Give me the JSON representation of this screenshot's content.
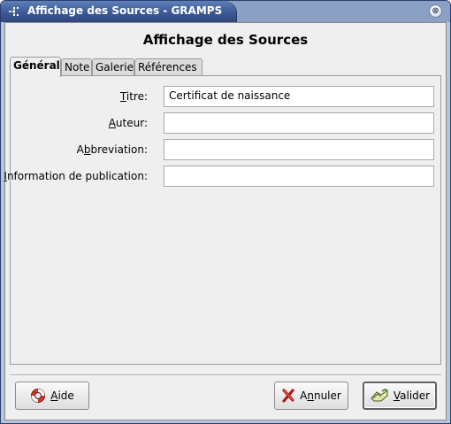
{
  "window": {
    "title": "Affichage des Sources - GRAMPS",
    "close_glyph": "⊗"
  },
  "dialog": {
    "heading": "Affichage des Sources"
  },
  "tabs": [
    {
      "label": "Général",
      "active": true
    },
    {
      "label": "Note",
      "active": false
    },
    {
      "label": "Galerie",
      "active": false
    },
    {
      "label": "Références",
      "active": false
    }
  ],
  "form": {
    "titre": {
      "label_mnemonic": "T",
      "label_rest": "itre:",
      "value": "Certificat de naissance"
    },
    "auteur": {
      "label_mnemonic": "A",
      "label_rest": "uteur:",
      "value": ""
    },
    "abbreviation": {
      "label_pre": "A",
      "label_mnemonic": "b",
      "label_rest": "breviation:",
      "value": ""
    },
    "publication": {
      "label_mnemonic": "I",
      "label_rest": "nformation de publication:",
      "value": ""
    }
  },
  "buttons": {
    "help": {
      "mnemonic": "A",
      "rest": "ide",
      "icon": "lifebuoy-icon"
    },
    "cancel": {
      "pre": "A",
      "mnemonic": "n",
      "rest": "nuler",
      "icon": "red-x-icon"
    },
    "ok": {
      "mnemonic": "V",
      "rest": "alider",
      "icon": "check-hand-icon"
    }
  }
}
